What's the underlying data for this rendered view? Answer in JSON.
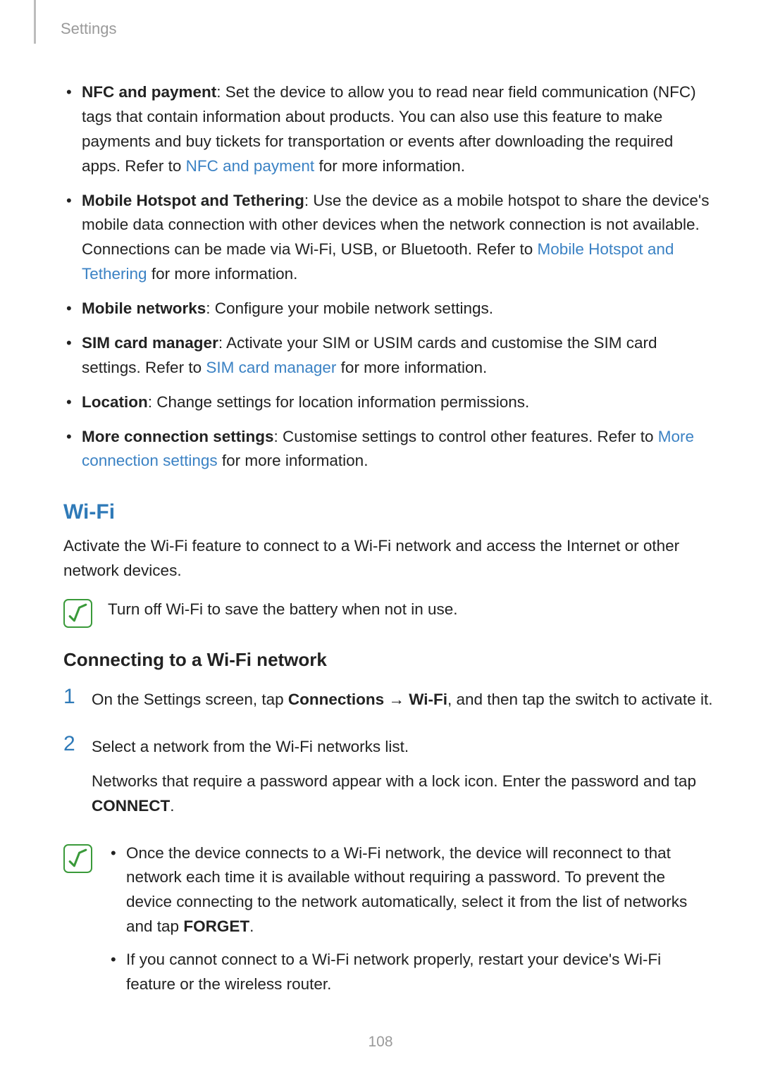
{
  "header": "Settings",
  "bullets": [
    {
      "title": "NFC and payment",
      "text_before_link": ": Set the device to allow you to read near field communication (NFC) tags that contain information about products. You can also use this feature to make payments and buy tickets for transportation or events after downloading the required apps. Refer to ",
      "link": "NFC and payment",
      "text_after_link": " for more information."
    },
    {
      "title": "Mobile Hotspot and Tethering",
      "text_before_link": ": Use the device as a mobile hotspot to share the device's mobile data connection with other devices when the network connection is not available. Connections can be made via Wi-Fi, USB, or Bluetooth. Refer to ",
      "link": "Mobile Hotspot and Tethering",
      "text_after_link": " for more information."
    },
    {
      "title": "Mobile networks",
      "text_before_link": ": Configure your mobile network settings.",
      "link": "",
      "text_after_link": ""
    },
    {
      "title": "SIM card manager",
      "text_before_link": ": Activate your SIM or USIM cards and customise the SIM card settings. Refer to ",
      "link": "SIM card manager",
      "text_after_link": " for more information."
    },
    {
      "title": "Location",
      "text_before_link": ": Change settings for location information permissions.",
      "link": "",
      "text_after_link": ""
    },
    {
      "title": "More connection settings",
      "text_before_link": ": Customise settings to control other features. Refer to ",
      "link": "More connection settings",
      "text_after_link": " for more information."
    }
  ],
  "wifi": {
    "heading": "Wi-Fi",
    "intro": "Activate the Wi-Fi feature to connect to a Wi-Fi network and access the Internet or other network devices.",
    "note": "Turn off Wi-Fi to save the battery when not in use.",
    "subheading": "Connecting to a Wi-Fi network",
    "step1_num": "1",
    "step1_a": "On the Settings screen, tap ",
    "step1_b": "Connections",
    "step1_c": " → ",
    "step1_d": "Wi-Fi",
    "step1_e": ", and then tap the switch to activate it.",
    "step2_num": "2",
    "step2_a": "Select a network from the Wi-Fi networks list.",
    "step2_b1": "Networks that require a password appear with a lock icon. Enter the password and tap ",
    "step2_b2": "CONNECT",
    "step2_b3": ".",
    "tips": [
      {
        "a": "Once the device connects to a Wi-Fi network, the device will reconnect to that network each time it is available without requiring a password. To prevent the device connecting to the network automatically, select it from the list of networks and tap ",
        "b": "FORGET",
        "c": "."
      },
      {
        "a": "If you cannot connect to a Wi-Fi network properly, restart your device's Wi-Fi feature or the wireless router.",
        "b": "",
        "c": ""
      }
    ]
  },
  "page_number": "108"
}
